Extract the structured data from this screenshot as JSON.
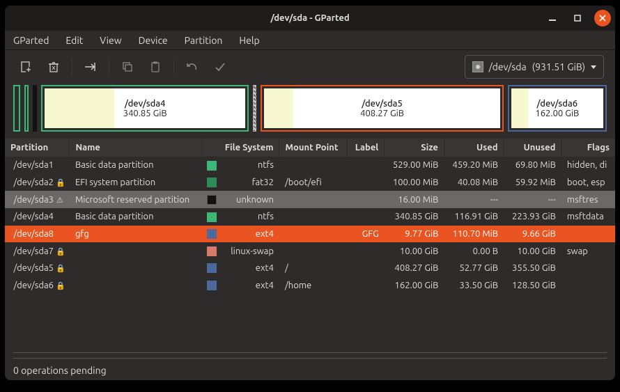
{
  "window": {
    "title": "/dev/sda - GParted"
  },
  "menu": {
    "items": [
      "GParted",
      "Edit",
      "View",
      "Device",
      "Partition",
      "Help"
    ]
  },
  "toolbar": {
    "icons": [
      "new",
      "delete",
      "resize-move",
      "copy",
      "paste",
      "undo",
      "apply"
    ],
    "disk": {
      "name": "/dev/sda",
      "size": "(931.51 GiB)"
    }
  },
  "diskmap": {
    "segments": [
      {
        "label": "/dev/sda4",
        "size": "340.85 GiB",
        "weight": 300,
        "color": "green"
      },
      {
        "label": "/dev/sda5",
        "size": "408.27 GiB",
        "weight": 352,
        "color": "orange"
      },
      {
        "label": "/dev/sda6",
        "size": "162.00 GiB",
        "weight": 143,
        "color": "blue"
      }
    ]
  },
  "table": {
    "headers": [
      "Partition",
      "Name",
      "File System",
      "Mount Point",
      "Label",
      "Size",
      "Used",
      "Unused",
      "Flags"
    ],
    "rows": [
      {
        "part": "/dev/sda1",
        "icon": "",
        "name": "Basic data partition",
        "fscolor": "sw-green",
        "fs": "ntfs",
        "mp": "",
        "label": "",
        "size": "529.00 MiB",
        "used": "459.20 MiB",
        "unused": "69.80 MiB",
        "flags": "hidden, di",
        "cls": ""
      },
      {
        "part": "/dev/sda2",
        "icon": "🔒",
        "name": "EFI system partition",
        "fscolor": "sw-dgreen",
        "fs": "fat32",
        "mp": "/boot/efi",
        "label": "",
        "size": "100.00 MiB",
        "used": "40.08 MiB",
        "unused": "59.92 MiB",
        "flags": "boot, esp",
        "cls": ""
      },
      {
        "part": "/dev/sda3",
        "icon": "⚠",
        "name": "Microsoft reserved partition",
        "fscolor": "sw-black",
        "fs": "unknown",
        "mp": "",
        "label": "",
        "size": "16.00 MiB",
        "used": "---",
        "unused": "---",
        "flags": "msftres",
        "cls": "selected-gray"
      },
      {
        "part": "/dev/sda4",
        "icon": "",
        "name": "Basic data partition",
        "fscolor": "sw-green",
        "fs": "ntfs",
        "mp": "",
        "label": "",
        "size": "340.85 GiB",
        "used": "116.91 GiB",
        "unused": "223.93 GiB",
        "flags": "msftdata",
        "cls": ""
      },
      {
        "part": "/dev/sda8",
        "icon": "",
        "name": "gfg",
        "fscolor": "sw-blue",
        "fs": "ext4",
        "mp": "",
        "label": "GFG",
        "size": "9.77 GiB",
        "used": "110.70 MiB",
        "unused": "9.66 GiB",
        "flags": "",
        "cls": "selected-orange"
      },
      {
        "part": "/dev/sda7",
        "icon": "🔒",
        "name": "",
        "fscolor": "sw-coral",
        "fs": "linux-swap",
        "mp": "",
        "label": "",
        "size": "10.00 GiB",
        "used": "0.00 B",
        "unused": "10.00 GiB",
        "flags": "swap",
        "cls": ""
      },
      {
        "part": "/dev/sda5",
        "icon": "🔒",
        "name": "",
        "fscolor": "sw-blue",
        "fs": "ext4",
        "mp": "/",
        "label": "",
        "size": "408.27 GiB",
        "used": "52.77 GiB",
        "unused": "355.50 GiB",
        "flags": "",
        "cls": ""
      },
      {
        "part": "/dev/sda6",
        "icon": "🔒",
        "name": "",
        "fscolor": "sw-blue",
        "fs": "ext4",
        "mp": "/home",
        "label": "",
        "size": "162.00 GiB",
        "used": "33.50 GiB",
        "unused": "128.50 GiB",
        "flags": "",
        "cls": ""
      }
    ]
  },
  "status": {
    "text": "0 operations pending"
  }
}
